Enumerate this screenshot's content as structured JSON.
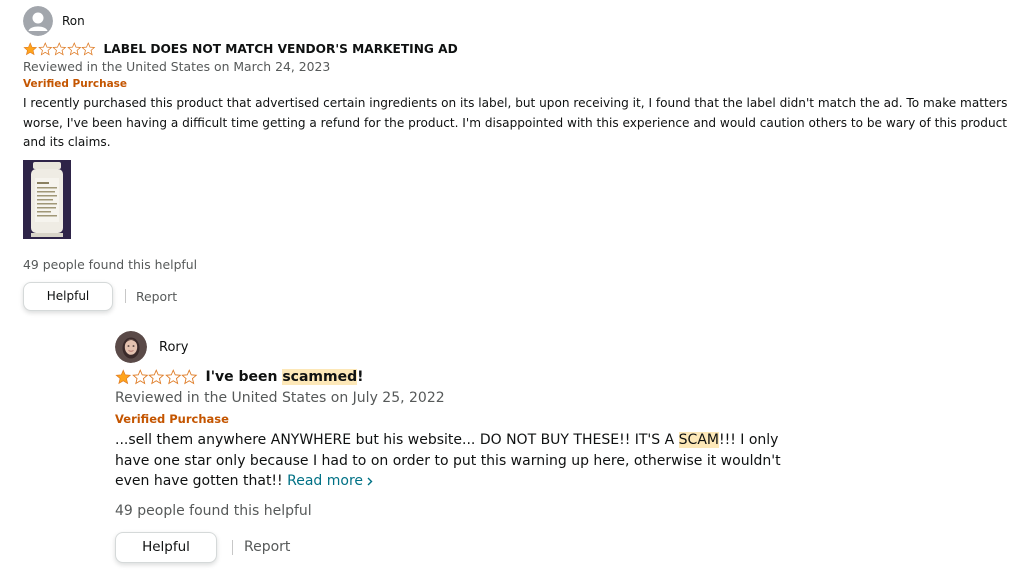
{
  "reviews": [
    {
      "reviewer": "Ron",
      "rating": 1,
      "max_rating": 5,
      "title": "LABEL DOES NOT MATCH VENDOR'S MARKETING AD",
      "meta": "Reviewed in the United States on March 24, 2023",
      "verified": "Verified Purchase",
      "body": "I recently purchased this product that advertised certain ingredients on its label, but upon receiving it, I found that the label didn't match the ad. To make matters worse, I've been having a difficult time getting a refund for the product. I'm disappointed with this experience and would caution others to be wary of this product and its claims.",
      "has_image": true,
      "helpful_count_text": "49 people found this helpful",
      "helpful_label": "Helpful",
      "report_label": "Report"
    },
    {
      "reviewer": "Rory",
      "rating": 1,
      "max_rating": 5,
      "title_before": "I've been ",
      "title_highlight": "scammed",
      "title_after": "!",
      "meta": "Reviewed in the United States on July 25, 2022",
      "verified": "Verified Purchase",
      "body_before": "...sell them anywhere ANYWHERE but his website... DO NOT BUY THESE!! IT'S A ",
      "body_highlight": "SCAM",
      "body_after": "!!! I only have one star only because I had to on order to put this warning up here, otherwise it wouldn't even have gotten that!! ",
      "read_more": "Read more",
      "helpful_count_text": "49 people found this helpful",
      "helpful_label": "Helpful",
      "report_label": "Report"
    }
  ],
  "colors": {
    "star": "#ffa41c",
    "verified": "#c45500",
    "link": "#007185",
    "highlight": "#fde8b8"
  },
  "icons": {
    "star_filled": "star-icon",
    "star_empty": "star-outline-icon",
    "avatar_default": "default-avatar-icon",
    "read_more_chevron": "chevron-right-icon"
  }
}
